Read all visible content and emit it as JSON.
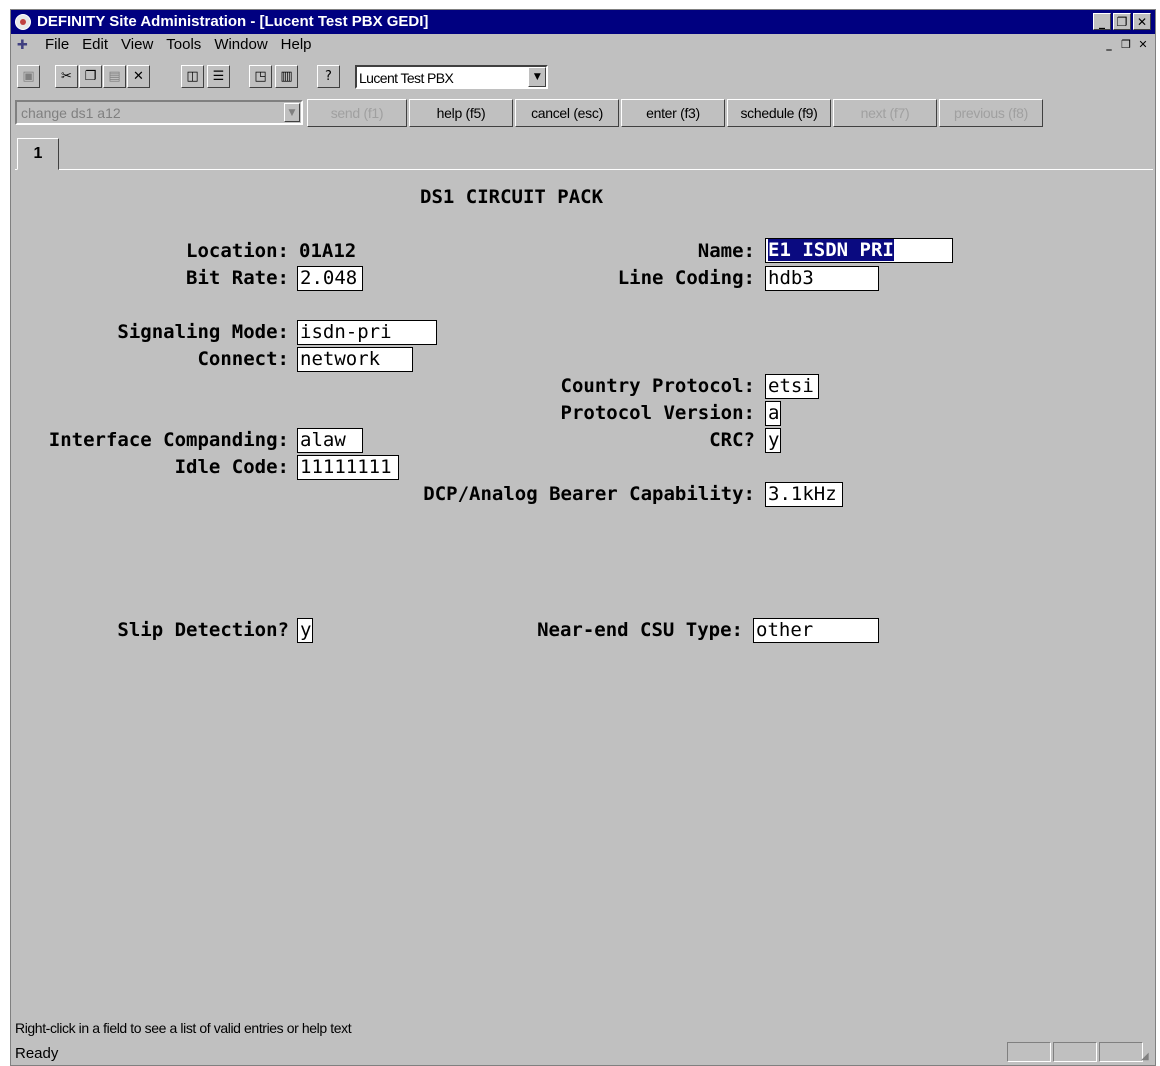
{
  "window": {
    "title": "DEFINITY Site Administration - [Lucent Test PBX GEDI]",
    "minimize": "_",
    "restore": "❐",
    "close": "✕",
    "doc_minimize": "_",
    "doc_restore": "❐",
    "doc_close": "✕"
  },
  "menu": {
    "items": [
      {
        "label": "File"
      },
      {
        "label": "Edit"
      },
      {
        "label": "View"
      },
      {
        "label": "Tools"
      },
      {
        "label": "Window"
      },
      {
        "label": "Help"
      }
    ]
  },
  "toolbar": {
    "icons": [
      "save-icon",
      "cut-icon",
      "copy-icon",
      "paste-icon",
      "delete-icon",
      "window-icon",
      "list-icon",
      "print-preview-icon",
      "print-icon",
      "help-icon"
    ],
    "pbx_select": "Lucent Test PBX"
  },
  "command_bar": {
    "command": "change ds1 a12",
    "buttons": {
      "send": "send (f1)",
      "help": "help (f5)",
      "cancel": "cancel (esc)",
      "enter": "enter (f3)",
      "schedule": "schedule (f9)",
      "next": "next (f7)",
      "previous": "previous (f8)"
    }
  },
  "tabs": [
    {
      "label": "1"
    }
  ],
  "form": {
    "title": "DS1 CIRCUIT PACK",
    "location_label": "Location:",
    "location_value": "01A12",
    "name_label": "Name:",
    "name_value": "E1 ISDN PRI",
    "bit_rate_label": "Bit Rate:",
    "bit_rate_value": "2.048",
    "line_coding_label": "Line Coding:",
    "line_coding_value": "hdb3",
    "signaling_mode_label": "Signaling Mode:",
    "signaling_mode_value": "isdn-pri",
    "connect_label": "Connect:",
    "connect_value": "network",
    "country_protocol_label": "Country Protocol:",
    "country_protocol_value": "etsi",
    "protocol_version_label": "Protocol Version:",
    "protocol_version_value": "a",
    "interface_companding_label": "Interface Companding:",
    "interface_companding_value": "alaw",
    "crc_label": "CRC?",
    "crc_value": "y",
    "idle_code_label": "Idle Code:",
    "idle_code_value": "11111111",
    "bearer_capability_label": "DCP/Analog Bearer Capability:",
    "bearer_capability_value": "3.1kHz",
    "slip_detection_label": "Slip Detection?",
    "slip_detection_value": "y",
    "csu_type_label": "Near-end CSU Type:",
    "csu_type_value": "other"
  },
  "status": {
    "hint": "Right-click in a field to see a list of valid entries or help text",
    "state": "Ready"
  }
}
